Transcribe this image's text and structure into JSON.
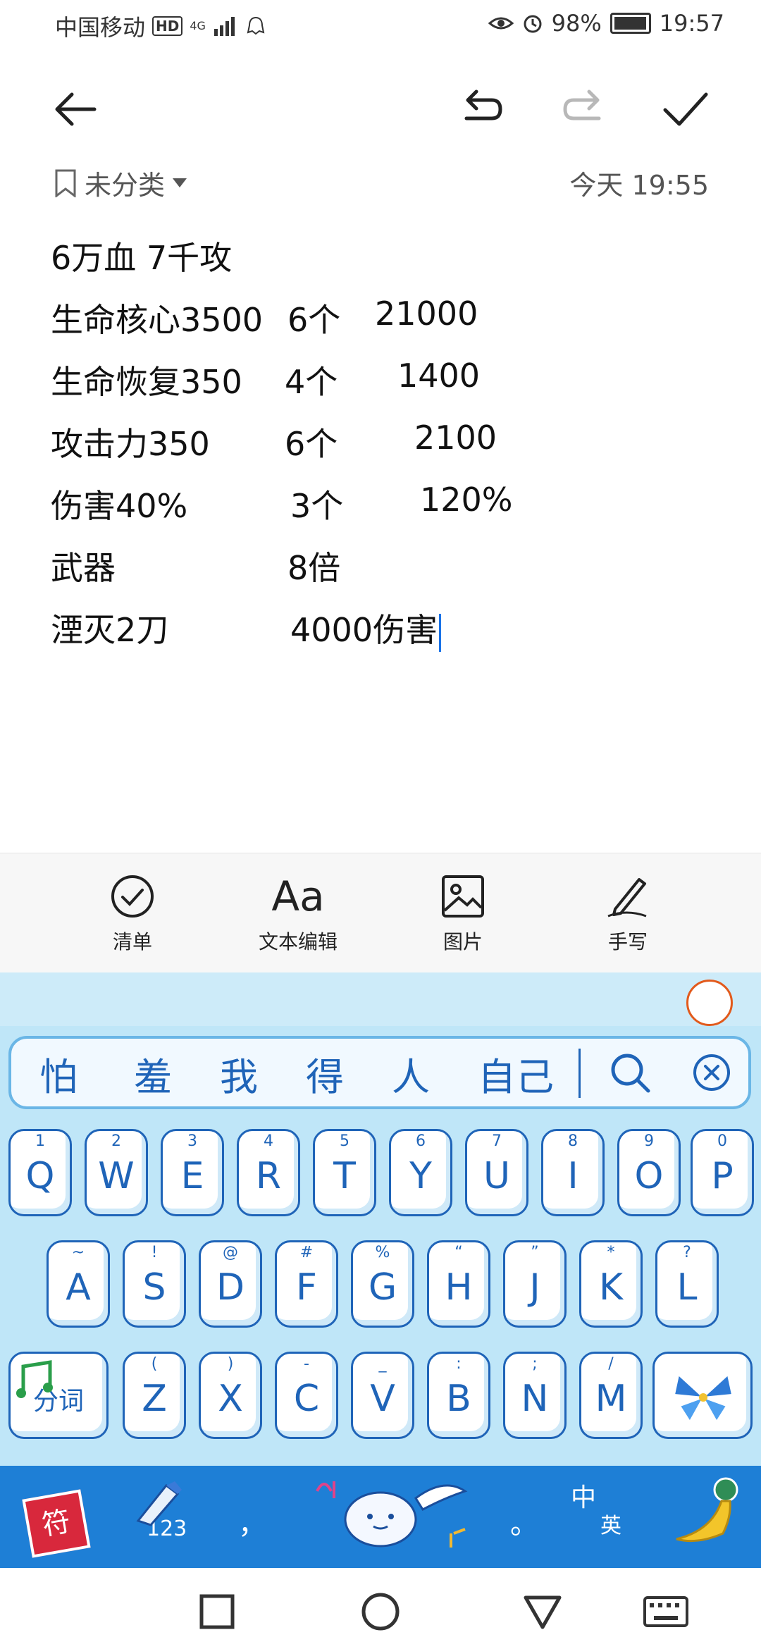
{
  "status_bar": {
    "carrier": "中国移动",
    "hd": "HD",
    "network": "4G",
    "battery": "98%",
    "time": "19:57"
  },
  "toolbar": {
    "back_icon": "arrow-left-icon",
    "undo_icon": "undo-icon",
    "redo_icon": "redo-icon",
    "confirm_icon": "check-icon"
  },
  "meta": {
    "category": "未分类",
    "timestamp": "今天 19:55"
  },
  "note": {
    "lines": [
      {
        "c1": "6万血 7千攻"
      },
      {
        "c1": "生命核心3500",
        "c2": "6个",
        "c3": "21000"
      },
      {
        "c1": "生命恢复350",
        "c2": "4个",
        "c3": "1400"
      },
      {
        "c1": "攻击力350",
        "c2": "6个",
        "c3": "2100"
      },
      {
        "c1": "伤害40%",
        "c2": "3个",
        "c3": "120%"
      },
      {
        "c1": "武器",
        "c2": "8倍"
      },
      {
        "c1": "湮灭2刀",
        "c2": "4000伤害"
      }
    ]
  },
  "actions": {
    "checklist": "清单",
    "text_edit": "文本编辑",
    "text_edit_glyph": "Aa",
    "image": "图片",
    "handwrite": "手写"
  },
  "keyboard": {
    "candidates": [
      "怕",
      "羞",
      "我",
      "得",
      "人",
      "自己"
    ],
    "row1": [
      {
        "k": "Q",
        "s": "1"
      },
      {
        "k": "W",
        "s": "2"
      },
      {
        "k": "E",
        "s": "3"
      },
      {
        "k": "R",
        "s": "4"
      },
      {
        "k": "T",
        "s": "5"
      },
      {
        "k": "Y",
        "s": "6"
      },
      {
        "k": "U",
        "s": "7"
      },
      {
        "k": "I",
        "s": "8"
      },
      {
        "k": "O",
        "s": "9"
      },
      {
        "k": "P",
        "s": "0"
      }
    ],
    "row2": [
      {
        "k": "A",
        "s": "~"
      },
      {
        "k": "S",
        "s": "!"
      },
      {
        "k": "D",
        "s": "@"
      },
      {
        "k": "F",
        "s": "#"
      },
      {
        "k": "G",
        "s": "%"
      },
      {
        "k": "H",
        "s": "“"
      },
      {
        "k": "J",
        "s": "”"
      },
      {
        "k": "K",
        "s": "*"
      },
      {
        "k": "L",
        "s": "?"
      }
    ],
    "row3": [
      {
        "k": "Z",
        "s": "("
      },
      {
        "k": "X",
        "s": ")"
      },
      {
        "k": "C",
        "s": "-"
      },
      {
        "k": "V",
        "s": "_"
      },
      {
        "k": "B",
        "s": ":"
      },
      {
        "k": "N",
        "s": ";"
      },
      {
        "k": "M",
        "s": "/"
      }
    ],
    "fenci": "分词",
    "symbol": "符",
    "num_key": "123",
    "comma": "，",
    "period": "。",
    "lang_cn": "中",
    "lang_en": "英"
  }
}
